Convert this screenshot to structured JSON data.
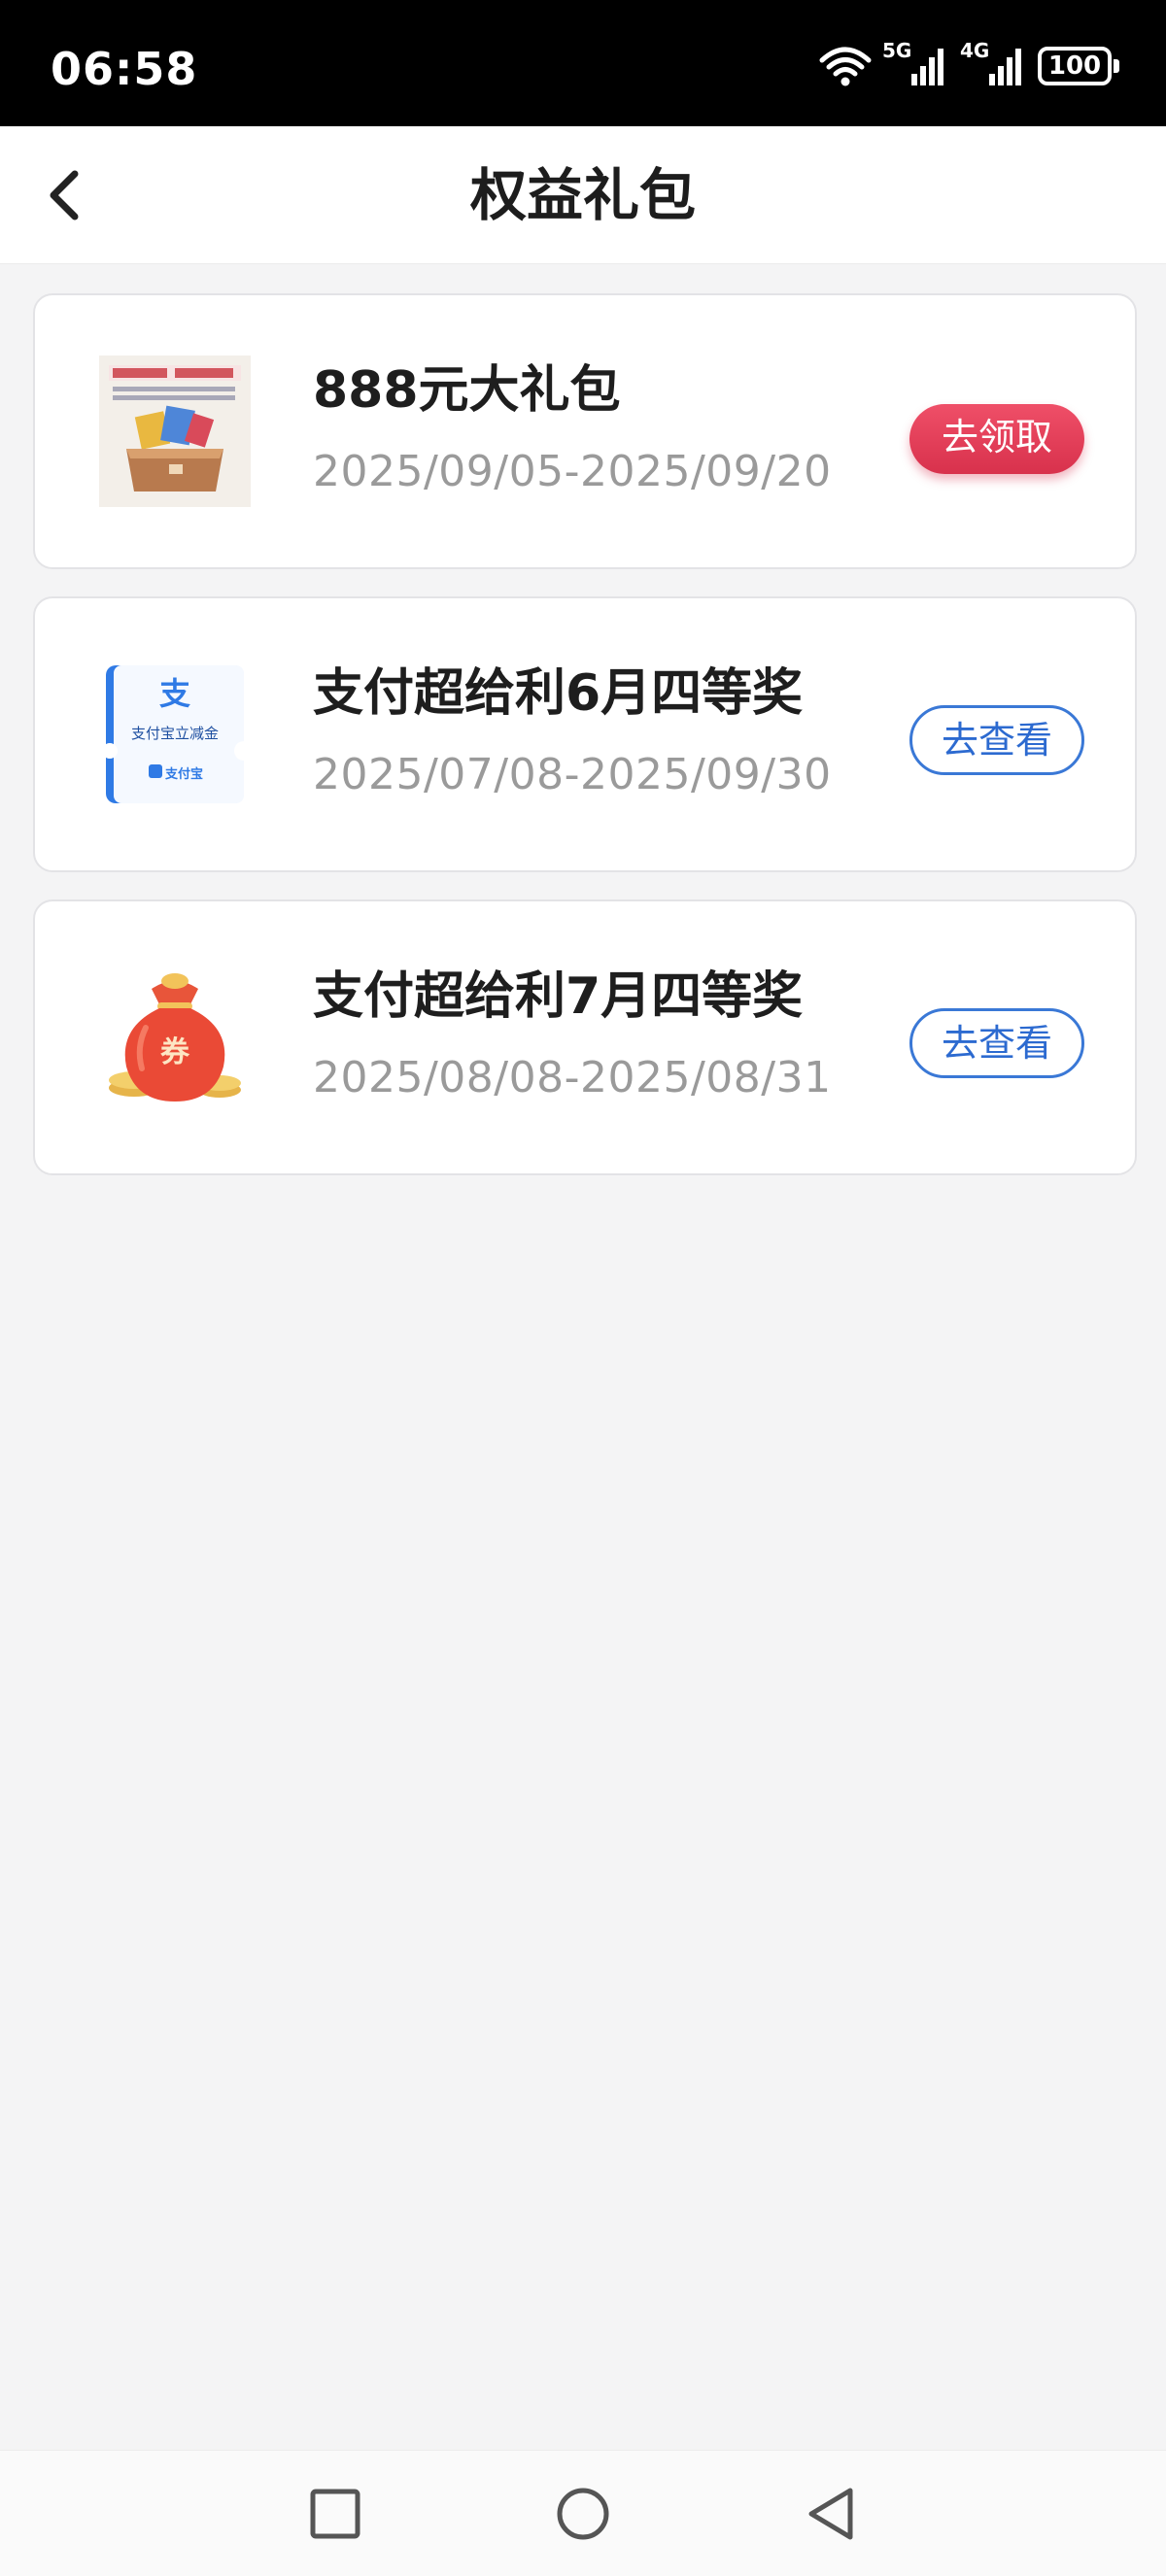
{
  "status_bar": {
    "time": "06:58",
    "network_5g": "5G",
    "network_4g": "4G",
    "battery": "100",
    "icons": [
      "wifi-icon",
      "signal-5g-icon",
      "signal-4g-icon",
      "battery-icon"
    ]
  },
  "header": {
    "title": "权益礼包",
    "back_icon": "chevron-left-icon"
  },
  "items": [
    {
      "title": "888元大礼包",
      "date_range": "2025/09/05-2025/09/20",
      "action_label": "去领取",
      "action_style": "claim",
      "thumb_icon": "gift-box-icon"
    },
    {
      "title": "支付超给利6月四等奖",
      "date_range": "2025/07/08-2025/09/30",
      "action_label": "去查看",
      "action_style": "view",
      "thumb_icon": "alipay-coupon-icon",
      "thumb_text": "支付宝立减金",
      "thumb_brand": "支付宝"
    },
    {
      "title": "支付超给利7月四等奖",
      "date_range": "2025/08/08-2025/08/31",
      "action_label": "去查看",
      "action_style": "view",
      "thumb_icon": "red-lucky-bag-icon",
      "thumb_text": "券"
    }
  ],
  "nav_bar": {
    "icons": [
      "recent-apps-icon",
      "home-icon",
      "back-triangle-icon"
    ]
  },
  "colors": {
    "claim_button": "#e23e58",
    "view_button_border": "#3a78d6",
    "page_background": "#f4f4f5"
  }
}
